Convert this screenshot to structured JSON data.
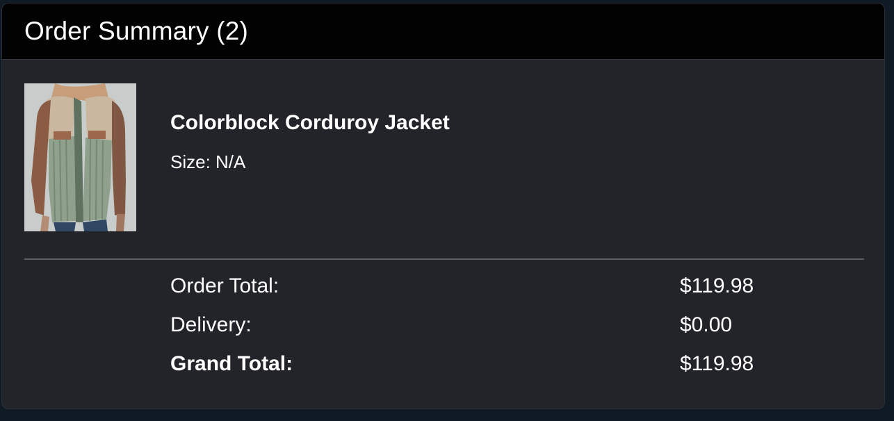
{
  "header": {
    "title": "Order Summary (2)"
  },
  "item": {
    "image_alt": "Colorblock Corduroy Jacket product photo",
    "name": "Colorblock Corduroy Jacket",
    "size_text": "Size: N/A"
  },
  "totals": {
    "order_total_label": "Order Total:",
    "order_total_value": "$119.98",
    "delivery_label": "Delivery:",
    "delivery_value": "$0.00",
    "grand_total_label": "Grand Total:",
    "grand_total_value": "$119.98"
  },
  "colors": {
    "background": "#0f1a24",
    "card": "#222429",
    "header": "#020202",
    "text": "#ffffff",
    "divider": "#5b5f66"
  }
}
